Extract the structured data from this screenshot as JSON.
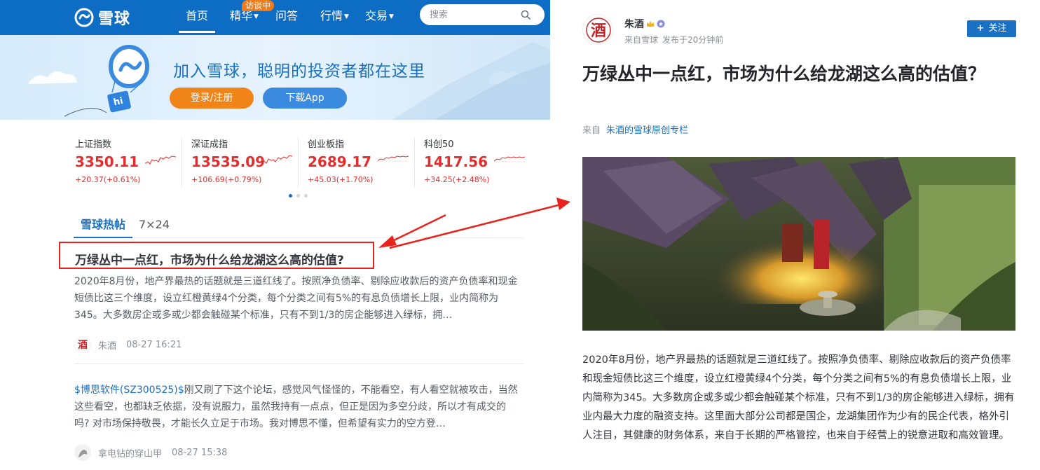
{
  "site": {
    "logo_text": "雪球",
    "nav": [
      {
        "label": "首页",
        "active": true
      },
      {
        "label": "精华",
        "dropdown": true
      },
      {
        "label": "问答"
      },
      {
        "label": "行情",
        "dropdown": true
      },
      {
        "label": "交易",
        "dropdown": true
      }
    ],
    "nav_badge": "访谈中",
    "search_placeholder": "搜索"
  },
  "banner": {
    "title": "加入雪球，聪明的投资者都在这里",
    "login_label": "登录/注册",
    "download_label": "下载App",
    "balloon_text": "hi"
  },
  "indices": [
    {
      "name": "上证指数",
      "value": "3350.11",
      "change": "+20.37(+0.61%)"
    },
    {
      "name": "深证成指",
      "value": "13535.09",
      "change": "+106.69(+0.79%)"
    },
    {
      "name": "创业板指",
      "value": "2689.17",
      "change": "+45.03(+1.70%)"
    },
    {
      "name": "科创50",
      "value": "1417.56",
      "change": "+34.25(+2.48%)"
    }
  ],
  "tabs": {
    "hot": "雪球热帖",
    "live": "7×24"
  },
  "posts": [
    {
      "title": "万绿丛中一点红，市场为什么给龙湖这么高的估值?",
      "body": "2020年8月份，地产界最热的话题就是三道红线了。按照净负债率、剔除应收款后的资产负债率和现金短债比这三个维度，设立红橙黄绿4个分类，每个分类之间有5%的有息负债增长上限，业内简称为345。大多数房企或多或少都会触碰某个标准，只有不到1/3的房企能够进入绿标，拥…",
      "author": "朱酒",
      "time": "08-27 16:21"
    },
    {
      "stock": "$博思软件(SZ300525)$",
      "body": "刚又刷了下这个论坛，感觉风气怪怪的，不能看空，有人看空就被攻击，当然这些看空，也都缺乏依据，没有说服力，虽然我持有一点点，但正是因为多空分歧，所以才有成交的吗? 对市场保持敬畏，才能长久立足于市场。我对博思不懂，但希望有实力的空方登…",
      "author": "拿电钻的穿山甲",
      "time": "08-27 15:38"
    }
  ],
  "article": {
    "author": "朱酒",
    "source": "来自雪球",
    "published": "发布于20分钟前",
    "follow_label": "关注",
    "title": "万绿丛中一点红，市场为什么给龙湖这么高的估值？",
    "from_label": "来自",
    "column": "朱酒的雪球原创专栏",
    "body": "2020年8月份，地产界最热的话题就是三道红线了。按照净负债率、剔除应收款后的资产负债率和现金短债比这三个维度，设立红橙黄绿4个分类，每个分类之间有5%的有息负债增长上限，业内简称为345。大多数房企或多或少都会触碰某个标准，只有不到1/3的房企能够进入绿标，拥有业内最大力度的融资支持。这里面大部分公司都是国企，龙湖集团作为少有的民企代表，格外引人注目，其健康的财务体系，来自于长期的严格管控，也来自于经营上的锐意进取和高效管理。"
  },
  "colors": {
    "brand_blue": "#0d6cc3",
    "up_red": "#e52d2d",
    "orange": "#f08419",
    "annotation_red": "#e8221c"
  }
}
